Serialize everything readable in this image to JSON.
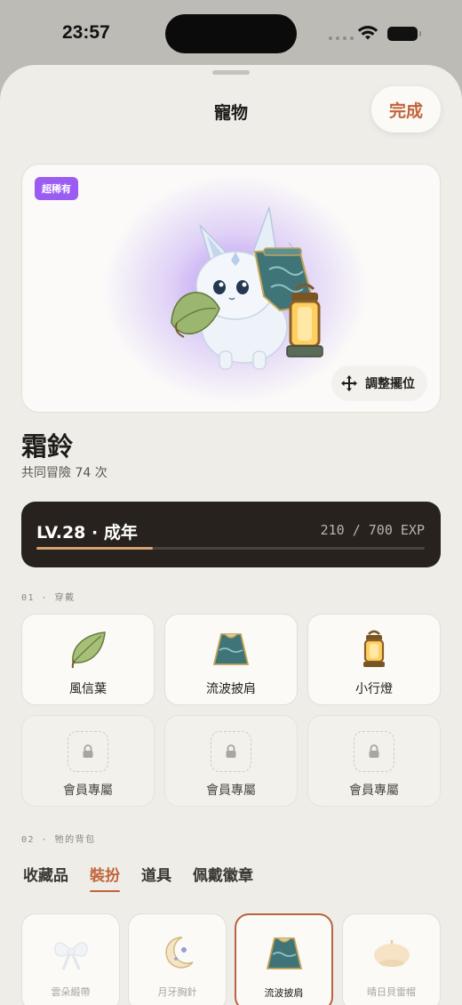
{
  "status": {
    "time": "23:57"
  },
  "sheet": {
    "title": "寵物",
    "done_label": "完成"
  },
  "pet": {
    "rarity": "超稀有",
    "adjust_label": "調整擺位",
    "name": "霜鈴",
    "adventures": "共同冒險 74 次",
    "level": "LV.28 · 成年",
    "exp": "210 / 700 EXP",
    "exp_current": 210,
    "exp_max": 700
  },
  "sections": {
    "wearing": "01 · 穿戴",
    "backpack": "02 · 牠的背包"
  },
  "equipped": [
    {
      "label": "風信葉",
      "icon": "leaf-icon"
    },
    {
      "label": "流波披肩",
      "icon": "cape-icon"
    },
    {
      "label": "小行燈",
      "icon": "lantern-icon"
    }
  ],
  "locked": [
    {
      "label": "會員專屬"
    },
    {
      "label": "會員專屬"
    },
    {
      "label": "會員專屬"
    }
  ],
  "tabs": [
    {
      "label": "收藏品"
    },
    {
      "label": "裝扮",
      "active": true
    },
    {
      "label": "道具"
    },
    {
      "label": "佩戴徽章"
    }
  ],
  "items": [
    {
      "label": "雲朵緞帶",
      "icon": "ribbon-icon"
    },
    {
      "label": "月牙胸針",
      "icon": "moon-brooch-icon"
    },
    {
      "label": "流波披肩",
      "icon": "cape-icon",
      "selected": true
    },
    {
      "label": "晴日貝雷帽",
      "icon": "beret-icon"
    }
  ],
  "colors": {
    "accent": "#c2643a",
    "rarity": "#9b5cf2",
    "level_bg": "#27221d",
    "exp_fill": "#d6a373"
  }
}
